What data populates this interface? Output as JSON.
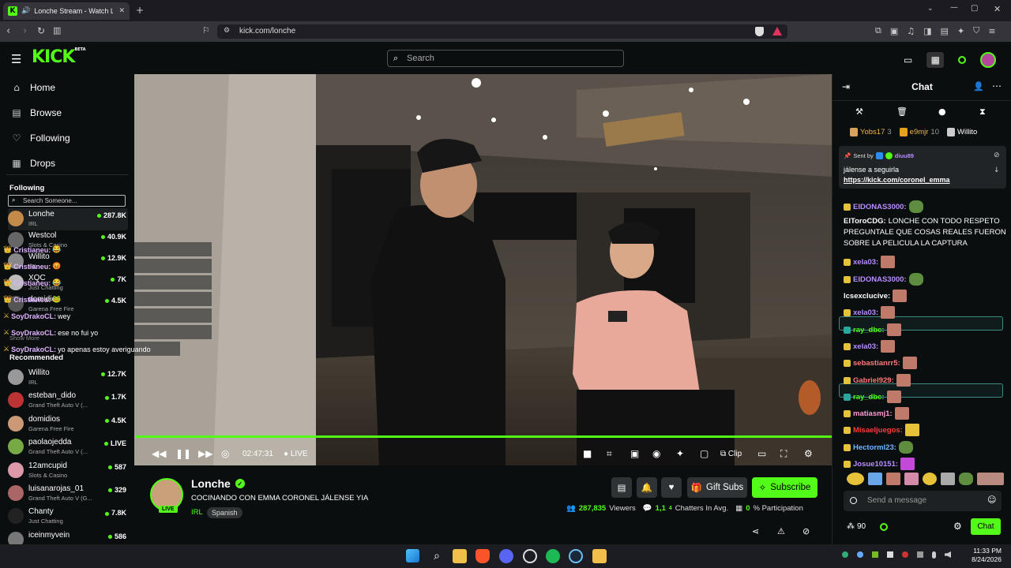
{
  "browser": {
    "tab_title": "Lonche Stream - Watch Live o",
    "url": "kick.com/lonche"
  },
  "header": {
    "logo": "KICK",
    "logo_sup": "BETA",
    "search_placeholder": "Search"
  },
  "sidebar": {
    "nav": [
      {
        "label": "Home",
        "icon": "home-icon"
      },
      {
        "label": "Browse",
        "icon": "browse-icon"
      },
      {
        "label": "Following",
        "icon": "heart-icon"
      },
      {
        "label": "Drops",
        "icon": "drops-icon"
      }
    ],
    "following_heading": "Following",
    "search_placeholder": "Search Someone...",
    "following": [
      {
        "name": "Lonche",
        "category": "IRL",
        "viewers": "287.8K",
        "color": "#c48a4a"
      },
      {
        "name": "Westcol",
        "category": "Slots & Casino",
        "viewers": "40.9K",
        "color": "#666"
      },
      {
        "name": "Willito",
        "category": "IRL",
        "viewers": "12.9K",
        "color": "#888"
      },
      {
        "name": "XQC",
        "category": "Just Chatting",
        "viewers": "7K",
        "color": "#bbb"
      },
      {
        "name": "domidios",
        "category": "Garena Free Fire",
        "viewers": "4.5K",
        "color": "#555"
      }
    ],
    "show_more": "Show More",
    "recommended_heading": "Recommended",
    "recommended": [
      {
        "name": "Willito",
        "category": "IRL",
        "viewers": "12.7K",
        "color": "#999"
      },
      {
        "name": "esteban_dido",
        "category": "Grand Theft Auto V (...",
        "viewers": "1.7K",
        "color": "#b33"
      },
      {
        "name": "domidios",
        "category": "Garena Free Fire",
        "viewers": "4.5K",
        "color": "#c97"
      },
      {
        "name": "paolaojedda",
        "category": "Grand Theft Auto V (...",
        "viewers": "LIVE",
        "color": "#7a4"
      },
      {
        "name": "12amcupid",
        "category": "Slots & Casino",
        "viewers": "587",
        "color": "#d9a"
      },
      {
        "name": "luisanarojas_01",
        "category": "Grand Theft Auto V (G...",
        "viewers": "329",
        "color": "#a66"
      },
      {
        "name": "Chanty",
        "category": "Just Chatting",
        "viewers": "7.8K",
        "color": "#222"
      },
      {
        "name": "iceinmyvein",
        "category": "",
        "viewers": "586",
        "color": "#777"
      }
    ]
  },
  "overlay_chat": [
    {
      "user": "Cristianeu:",
      "text": "😂",
      "prefix": "👑"
    },
    {
      "user": "Cristianeu:",
      "text": "😡",
      "prefix": "👑"
    },
    {
      "user": "Cristianeu:",
      "text": "😂",
      "prefix": "👑"
    },
    {
      "user": "Cristianeu:",
      "text": "🐸",
      "prefix": "👑"
    },
    {
      "user": "SoyDrakoCL:",
      "text": "wey",
      "prefix": "⚔"
    },
    {
      "user": "SoyDrakoCL:",
      "text": "ese no fui yo",
      "prefix": "⚔"
    },
    {
      "user": "SoyDrakoCL:",
      "text": "yo apenas estoy averiguando",
      "prefix": "⚔"
    }
  ],
  "player": {
    "time": "02:47:31",
    "live_label": "LIVE",
    "clip_label": "Clip",
    "progress_percent": 100
  },
  "stream": {
    "channel": "Lonche",
    "title": "COCINANDO CON EMMA CORONEL JÁLENSE YIA",
    "category": "IRL",
    "language": "Spanish",
    "live_badge": "LIVE",
    "gift_subs": "Gift Subs",
    "subscribe": "Subscribe",
    "viewers": "287,835",
    "viewers_label": "Viewers",
    "chatters": "1,1",
    "chatters_frac": "4",
    "chatters_label": "Chatters In Avg.",
    "participation": "0",
    "participation_label": "% Participation"
  },
  "chat": {
    "title": "Chat",
    "top_gifters": [
      {
        "name": "Yobs17",
        "count": "3"
      },
      {
        "name": "e9mjr",
        "count": "10"
      },
      {
        "name": "Willito",
        "count": ""
      }
    ],
    "pinned": {
      "sent_by": "Sent by",
      "user": "diuu89",
      "text": "jálense a seguirla",
      "link": "https://kick.com/coronel_emma"
    },
    "messages": [
      {
        "user": "EIDONAS3000:",
        "text": "",
        "ucolor": "#b98cff",
        "emote": "g"
      },
      {
        "user": "ElToroCDG:",
        "text": "LONCHE CON TODO RESPETO",
        "ucolor": "#fff",
        "emote": ""
      },
      {
        "user": "",
        "text": "PREGUNTALE QUE COSAS REALES FUERON",
        "ucolor": "#fff",
        "emote": ""
      },
      {
        "user": "",
        "text": "SOBRE LA PELICULA LA CAPTURA",
        "ucolor": "#fff",
        "emote": ""
      },
      {
        "user": "xela03:",
        "text": "",
        "ucolor": "#b98cff",
        "emote": "p"
      },
      {
        "user": "EIDONAS3000:",
        "text": "",
        "ucolor": "#b98cff",
        "emote": "g"
      },
      {
        "user": "lcsexclucive:",
        "text": "",
        "ucolor": "#fff",
        "emote": "p"
      },
      {
        "user": "xela03:",
        "text": "",
        "ucolor": "#b98cff",
        "emote": "p"
      },
      {
        "user": "ray_dbc:",
        "text": "",
        "ucolor": "#53fc18",
        "emote": "p"
      },
      {
        "user": "xela03:",
        "text": "",
        "ucolor": "#b98cff",
        "emote": "p"
      },
      {
        "user": "sebastianrr5:",
        "text": "",
        "ucolor": "#ff7a7a",
        "emote": "p"
      },
      {
        "user": "Gabriel929:",
        "text": "",
        "ucolor": "#ff7a7a",
        "emote": "p"
      },
      {
        "user": "ray_dbc:",
        "text": "",
        "ucolor": "#53fc18",
        "emote": "p"
      },
      {
        "user": "matiasmj1:",
        "text": "",
        "ucolor": "#ff9ad5",
        "emote": "p"
      },
      {
        "user": "Misaeljuegos:",
        "text": "",
        "ucolor": "#ff3b3b",
        "emote": "y"
      },
      {
        "user": "Hectorml23:",
        "text": "",
        "ucolor": "#6fb7ff",
        "emote": "g"
      },
      {
        "user": "Josue10151:",
        "text": "",
        "ucolor": "#b98cff",
        "emote": "m"
      }
    ],
    "input_placeholder": "Send a message",
    "points": "90",
    "send_label": "Chat"
  },
  "taskbar": {
    "time": "11:33 PM",
    "date": "8/24/2026"
  },
  "colors": {
    "brand": "#53fc18",
    "bg": "#0b0e0f"
  }
}
